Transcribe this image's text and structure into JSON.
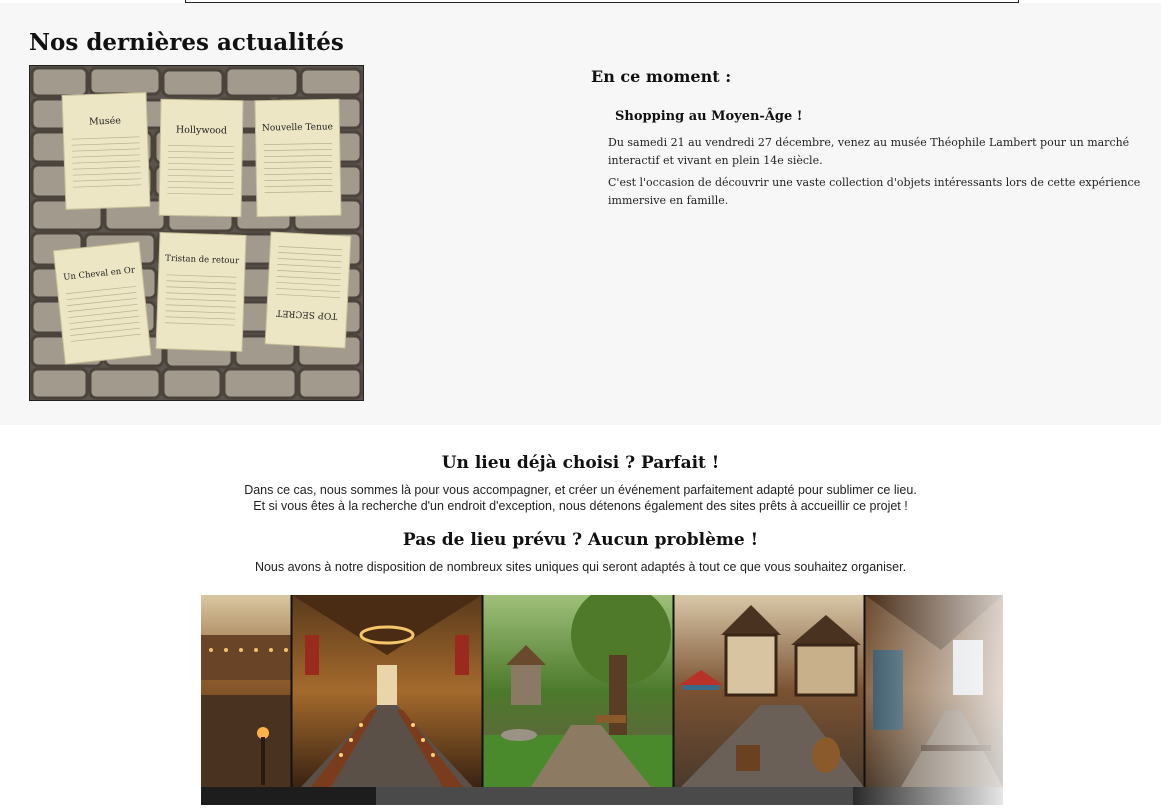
{
  "news": {
    "title": "Nos dernières actualités",
    "notes": [
      {
        "label": "Musée"
      },
      {
        "label": "Hollywood"
      },
      {
        "label": "Nouvelle Tenue"
      },
      {
        "label": "Un Cheval en Or"
      },
      {
        "label": "Tristan de retour"
      },
      {
        "label": "TOP SECRET"
      }
    ]
  },
  "current": {
    "title": "En ce moment :",
    "event_title": "Shopping au Moyen-Âge !",
    "paragraph_1": "Du samedi 21 au vendredi 27 décembre, venez au musée Théophile Lambert pour un marché interactif et vivant en plein 14e siècle.",
    "paragraph_2": "C'est l'occasion de découvrir une vaste collection d'objets intéressants lors de cette expérience immersive en famille."
  },
  "venue": {
    "heading_1": "Un lieu déjà choisi ? Parfait !",
    "text_1a": "Dans ce cas, nous sommes là pour vous accompagner, et créer un événement parfaitement adapté pour sublimer ce lieu.",
    "text_1b": "Et si vous êtes à la recherche d'un endroit d'exception, nous détenons également des sites prêts à accueillir ce projet !",
    "heading_2": "Pas de lieu prévu ? Aucun problème !",
    "text_2": "Nous avons à notre disposition de nombreux sites uniques qui seront adaptés à tout ce que vous souhaitez organiser."
  },
  "colors": {
    "page_bg": "#ffffff",
    "section_bg": "#f7f7f7",
    "paper": "#ece6c4",
    "stone": "#9e9588"
  }
}
